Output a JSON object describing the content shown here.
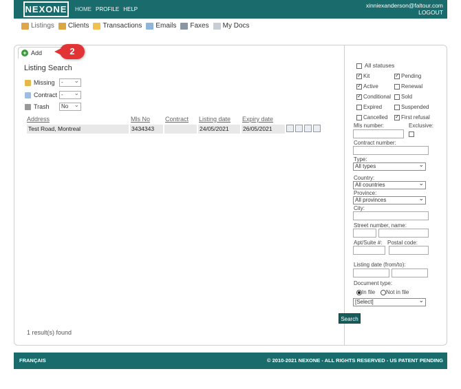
{
  "header": {
    "logo": "NEXONE",
    "nav": [
      "HOME",
      "PROFILE",
      "HELP"
    ],
    "user_email": "xinniexanderson@faltour.com",
    "logout": "LOGOUT"
  },
  "tabs": [
    {
      "label": "Listings",
      "icon": "house-icon"
    },
    {
      "label": "Clients",
      "icon": "clients-icon"
    },
    {
      "label": "Transactions",
      "icon": "folder-icon"
    },
    {
      "label": "Emails",
      "icon": "envelope-icon"
    },
    {
      "label": "Faxes",
      "icon": "fax-icon"
    },
    {
      "label": "My Docs",
      "icon": "docs-icon"
    }
  ],
  "add": {
    "label": "Add",
    "badge": "2"
  },
  "listing": {
    "title": "Listing Search",
    "filters": [
      {
        "label": "Missing",
        "value": "-"
      },
      {
        "label": "Contract",
        "value": "-"
      },
      {
        "label": "Trash",
        "value": "No"
      }
    ],
    "columns": [
      "Address",
      "Mls No",
      "Contract",
      "Listing date",
      "Expiry date"
    ],
    "rows": [
      {
        "address": "Test Road, Montreal",
        "mls": "3434343",
        "contract": "",
        "listing_date": "24/05/2021",
        "expiry_date": "26/05/2021"
      }
    ],
    "result": "1 result(s) found"
  },
  "search": {
    "all_statuses": "All statuses",
    "statuses": [
      {
        "label": "Kit",
        "checked": true
      },
      {
        "label": "Pending",
        "checked": true
      },
      {
        "label": "Active",
        "checked": true
      },
      {
        "label": "Renewal",
        "checked": false
      },
      {
        "label": "Conditional",
        "checked": true
      },
      {
        "label": "Sold",
        "checked": false
      },
      {
        "label": "Expired",
        "checked": false
      },
      {
        "label": "Suspended",
        "checked": false
      },
      {
        "label": "Cancelled",
        "checked": false
      },
      {
        "label": "First refusal",
        "checked": true
      }
    ],
    "mls_label": "Mls number:",
    "exclusive_label": "Exclusive:",
    "contract_label": "Contract number:",
    "type_label": "Type:",
    "type_value": "All types",
    "country_label": "Country:",
    "country_value": "All countries",
    "province_label": "Province:",
    "province_value": "All provinces",
    "city_label": "City:",
    "street_label": "Street number, name:",
    "apt_label": "Apt/Suite #:",
    "postal_label": "Postal code:",
    "listing_date_label": "Listing date (from/to):",
    "doctype_label": "Document type:",
    "in_file": "In file",
    "not_in_file": "Not in file",
    "doctype_value": "[Select]",
    "button": "Search"
  },
  "footer": {
    "lang": "FRANÇAIS",
    "copyright": "© 2010-2021 NEXONE - ALL RIGHTS RESERVED - US PATENT PENDING"
  },
  "colors": {
    "brand": "#1a6b6b",
    "badge": "#e23434"
  }
}
